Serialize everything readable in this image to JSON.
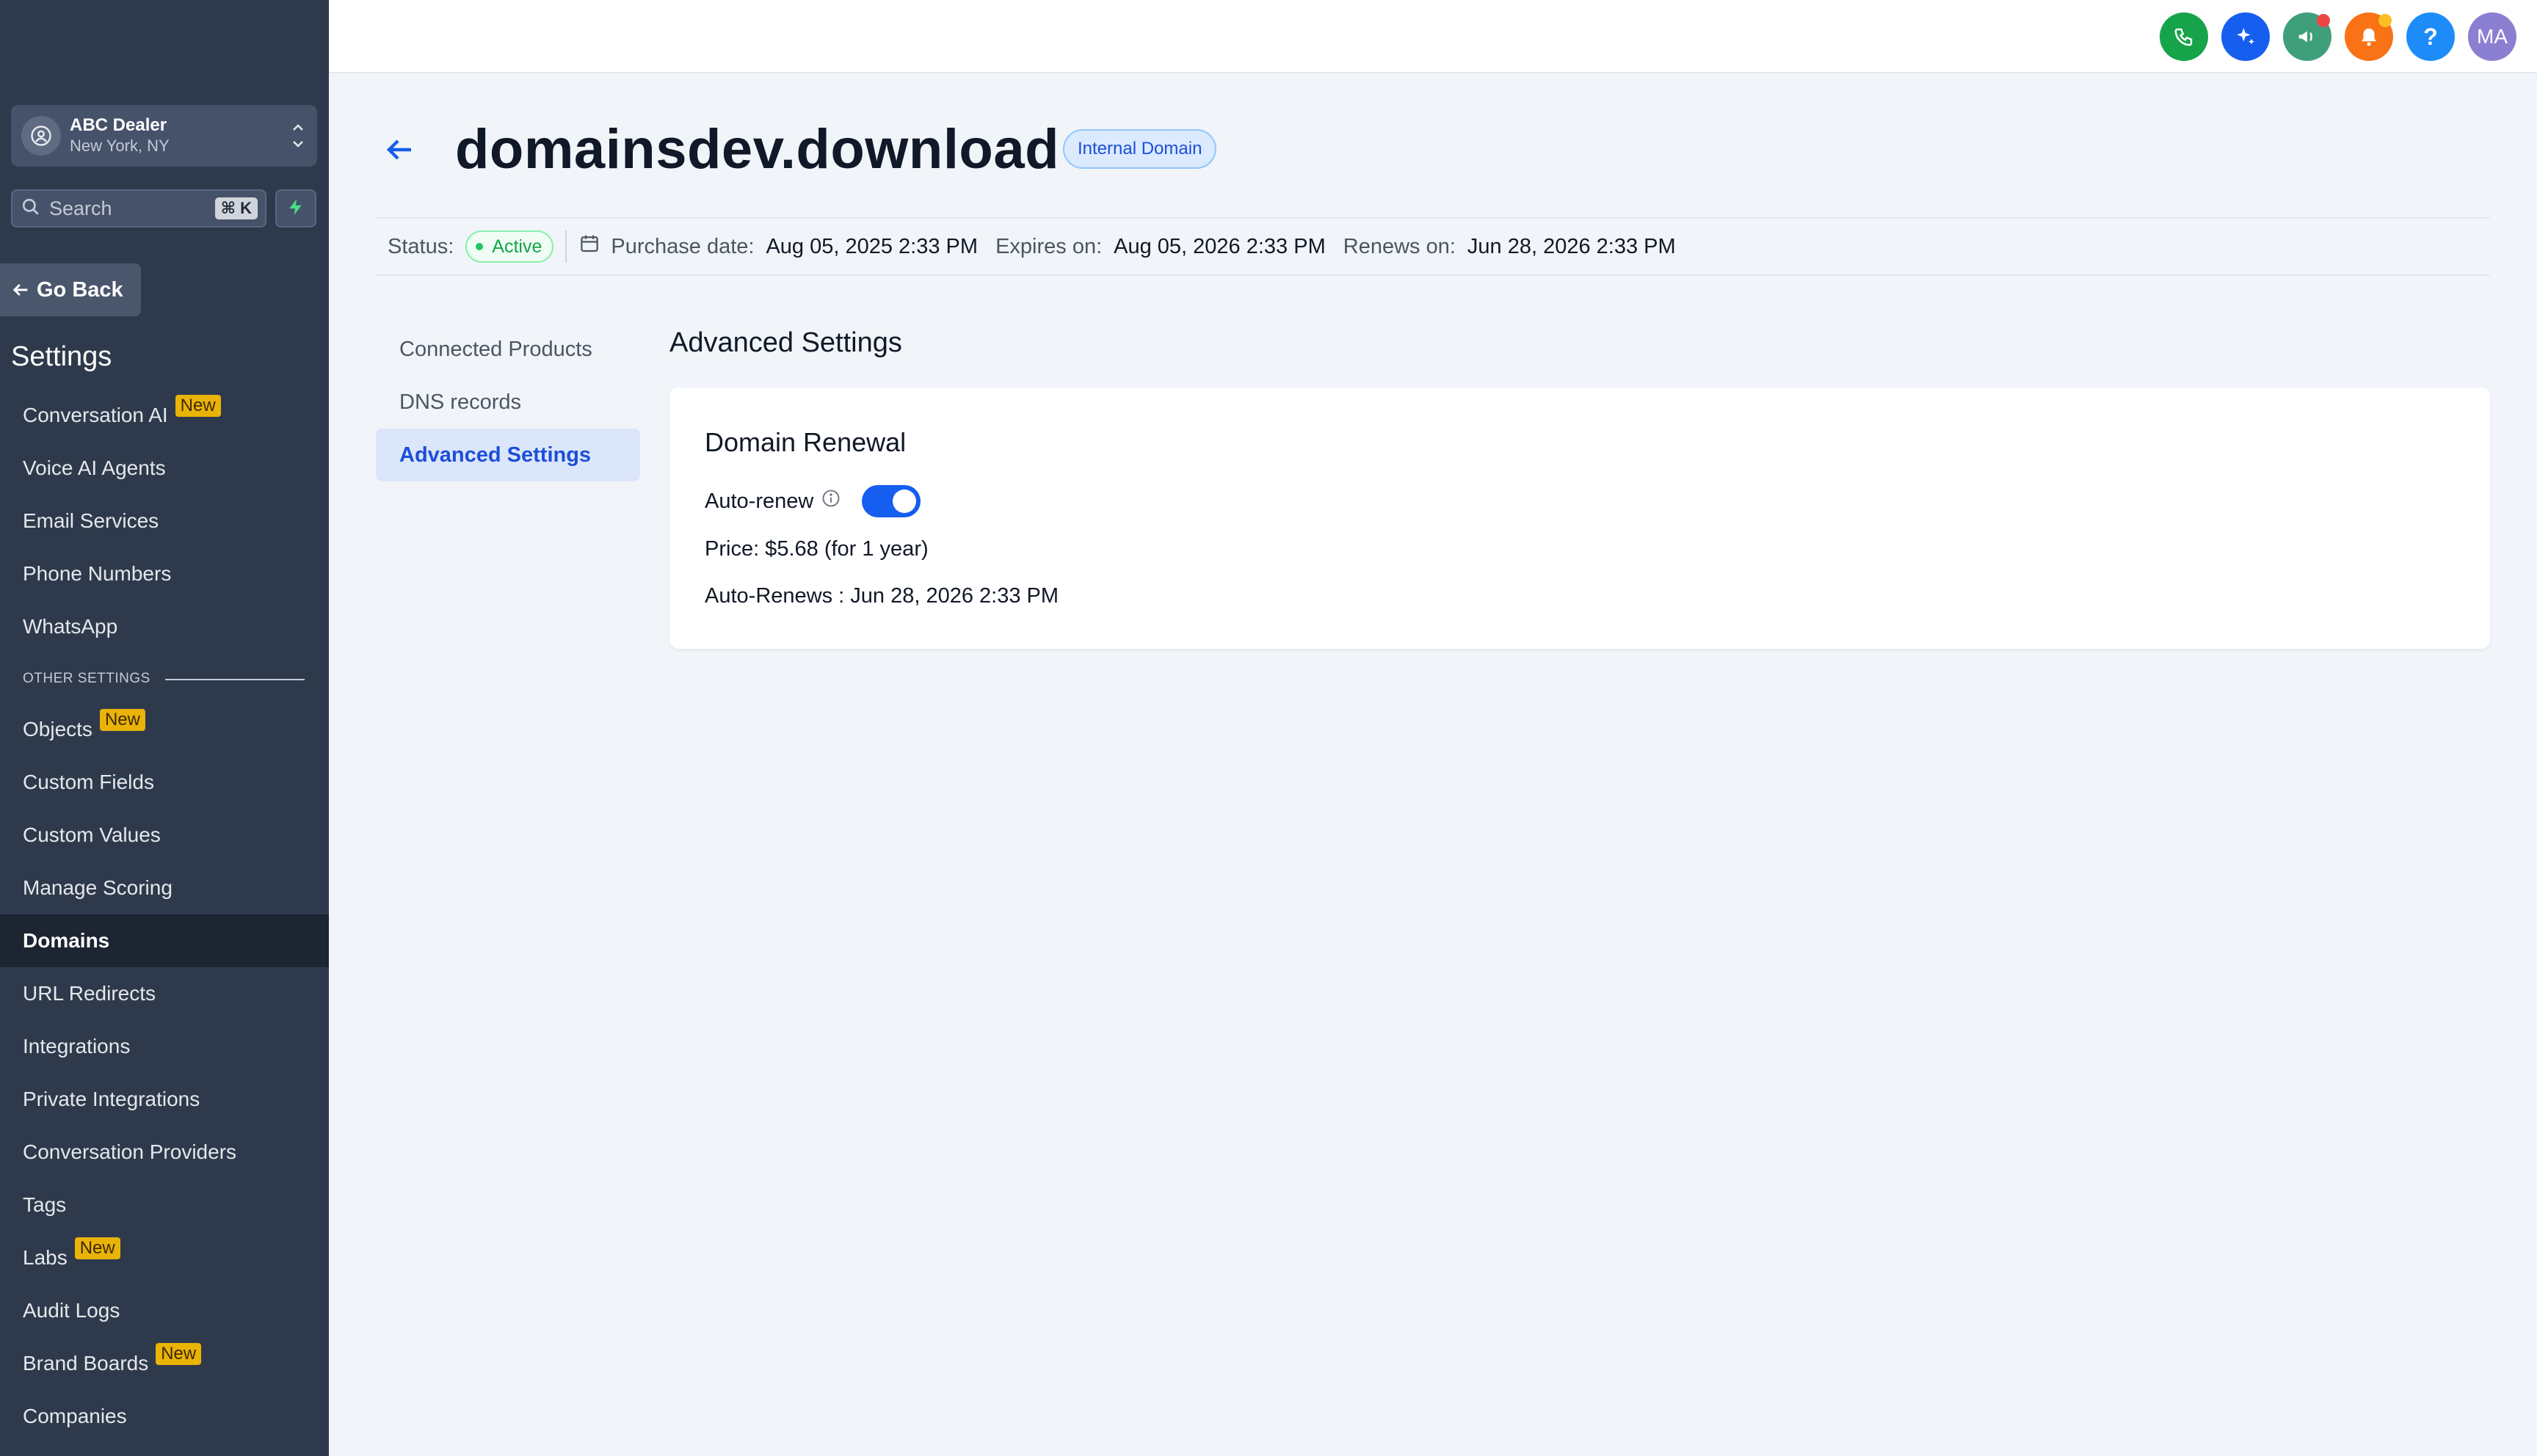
{
  "sidebar": {
    "location": {
      "name": "ABC Dealer",
      "city": "New York, NY"
    },
    "search": {
      "placeholder": "Search",
      "shortcut": "⌘ K"
    },
    "go_back_label": "Go Back",
    "settings_title": "Settings",
    "items": [
      {
        "label": "Conversation AI",
        "badge": "New"
      },
      {
        "label": "Voice AI Agents"
      },
      {
        "label": "Email Services"
      },
      {
        "label": "Phone Numbers"
      },
      {
        "label": "WhatsApp"
      }
    ],
    "other_settings_label": "OTHER SETTINGS",
    "other_items": [
      {
        "label": "Objects",
        "badge": "New"
      },
      {
        "label": "Custom Fields"
      },
      {
        "label": "Custom Values"
      },
      {
        "label": "Manage Scoring"
      },
      {
        "label": "Domains",
        "active": true
      },
      {
        "label": "URL Redirects"
      },
      {
        "label": "Integrations"
      },
      {
        "label": "Private Integrations"
      },
      {
        "label": "Conversation Providers"
      },
      {
        "label": "Tags"
      },
      {
        "label": "Labs",
        "badge": "New"
      },
      {
        "label": "Audit Logs"
      },
      {
        "label": "Brand Boards",
        "badge": "New"
      },
      {
        "label": "Companies"
      }
    ]
  },
  "topbar": {
    "icons": [
      {
        "name": "phone-icon",
        "color": "#16a34a"
      },
      {
        "name": "sparkle-icon",
        "color": "#155eef"
      },
      {
        "name": "megaphone-icon",
        "color": "#3f9f7a"
      },
      {
        "name": "bell-icon",
        "color": "#f97316"
      },
      {
        "name": "help-icon",
        "color": "#1d8cf8",
        "glyph": "?"
      }
    ],
    "avatar_initials": "MA",
    "avatar_color": "#8b7fd1"
  },
  "domain": {
    "name": "domainsdev.download",
    "type_badge": "Internal Domain"
  },
  "meta": {
    "status_label": "Status:",
    "status_value": "Active",
    "purchase_label": "Purchase date:",
    "purchase_value": "Aug 05, 2025 2:33 PM",
    "expires_label": "Expires on:",
    "expires_value": "Aug 05, 2026 2:33 PM",
    "renews_label": "Renews on:",
    "renews_value": "Jun 28, 2026 2:33 PM"
  },
  "subnav": [
    {
      "label": "Connected Products"
    },
    {
      "label": "DNS records"
    },
    {
      "label": "Advanced Settings",
      "active": true
    }
  ],
  "panel": {
    "title": "Advanced Settings",
    "card_title": "Domain Renewal",
    "auto_renew_label": "Auto-renew",
    "auto_renew_enabled": true,
    "price_text": "Price: $5.68 (for 1 year)",
    "auto_renews_text": "Auto-Renews : Jun 28, 2026 2:33 PM"
  },
  "colors": {
    "sidebar_bg": "#2e3a4c",
    "accent": "#155eef",
    "badge_new": "#eab308",
    "status_active": "#16a34a"
  }
}
